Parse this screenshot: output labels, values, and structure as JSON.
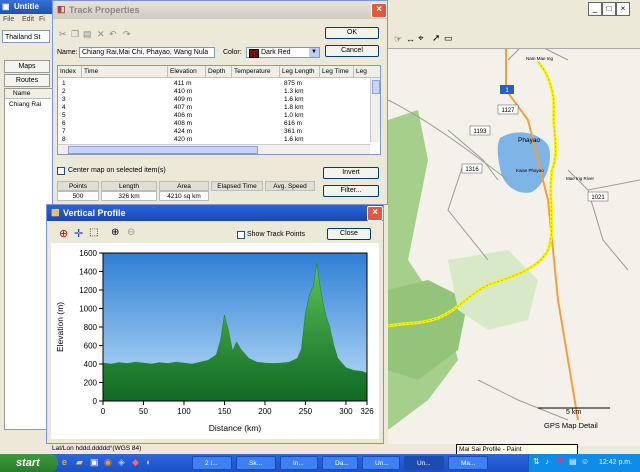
{
  "background_app": {
    "title": "Untitle",
    "menu": [
      "File",
      "Edit",
      "Fi"
    ],
    "region_combo": "Thailand St",
    "tabs": [
      "Maps",
      "Routes"
    ],
    "list_header": "Name",
    "list_item": "Chiang Rai"
  },
  "map": {
    "towns": [
      "Nam Mae Ing",
      "Phayao",
      "Kwan Phayao",
      "Mae Ing River"
    ],
    "road_labels": [
      "1",
      "1127",
      "1193",
      "1316",
      "1021"
    ],
    "scale_label": "5 km",
    "attribution": "GPS Map Detail",
    "colors": {
      "land": "#f3f1ea",
      "forest": "#a6cf8c",
      "lake": "#7fb5e6",
      "route": "#f5f500",
      "highway": "#f0a040"
    }
  },
  "track_properties": {
    "title": "Track Properties",
    "name_label": "Name:",
    "name_value": "Chiang Rai,Mai Chi, Phayao, Wang Nula",
    "color_label": "Color:",
    "color_value": "Dark Red",
    "color_swatch": "#7a0b0b",
    "ok_label": "OK",
    "cancel_label": "Cancel",
    "columns": [
      "Index",
      "Time",
      "Elevation",
      "Depth",
      "Temperature",
      "Leg Length",
      "Leg Time",
      "Leg"
    ],
    "rows": [
      {
        "index": "1",
        "elevation": "411 m",
        "leg_length": "875 m"
      },
      {
        "index": "2",
        "elevation": "410 m",
        "leg_length": "1.3 km"
      },
      {
        "index": "3",
        "elevation": "409 m",
        "leg_length": "1.6 km"
      },
      {
        "index": "4",
        "elevation": "407 m",
        "leg_length": "1.8 km"
      },
      {
        "index": "5",
        "elevation": "406 m",
        "leg_length": "1.0 km"
      },
      {
        "index": "6",
        "elevation": "408 m",
        "leg_length": "616 m"
      },
      {
        "index": "7",
        "elevation": "424 m",
        "leg_length": "361 m"
      },
      {
        "index": "8",
        "elevation": "420 m",
        "leg_length": "1.6 km"
      }
    ],
    "center_map_label": "Center map on selected item(s)",
    "invert_label": "Invert",
    "filter_label": "Filter...",
    "stats_headers": [
      "Points",
      "Length",
      "Area",
      "Elapsed Time",
      "Avg. Speed"
    ],
    "stats_values": [
      "500",
      "326 km",
      "4210 sq km",
      "",
      ""
    ]
  },
  "vertical_profile": {
    "title": "Vertical Profile",
    "show_track_points_label": "Show Track Points",
    "close_label": "Close"
  },
  "chart_data": {
    "type": "area",
    "title": "",
    "xlabel": "Distance   (km)",
    "ylabel": "Elevation  (m)",
    "xlim": [
      0,
      326
    ],
    "ylim": [
      0,
      1600
    ],
    "x_ticks": [
      0,
      50,
      100,
      150,
      200,
      250,
      300,
      326
    ],
    "y_ticks": [
      0,
      200,
      400,
      600,
      800,
      1000,
      1200,
      1400,
      1600
    ],
    "grid": false,
    "series": [
      {
        "color": "#1d8a2e",
        "x": [
          0,
          10,
          20,
          30,
          40,
          50,
          60,
          70,
          80,
          90,
          100,
          110,
          120,
          130,
          140,
          145,
          150,
          155,
          160,
          165,
          170,
          180,
          190,
          200,
          210,
          220,
          230,
          240,
          245,
          250,
          255,
          260,
          264,
          268,
          272,
          276,
          280,
          285,
          290,
          300,
          310,
          320,
          326
        ],
        "y": [
          410,
          400,
          415,
          405,
          420,
          410,
          400,
          415,
          405,
          420,
          410,
          400,
          420,
          440,
          500,
          650,
          930,
          760,
          540,
          640,
          560,
          460,
          420,
          410,
          405,
          410,
          420,
          460,
          560,
          950,
          1150,
          1250,
          1490,
          1250,
          1050,
          900,
          800,
          600,
          460,
          360,
          330,
          320,
          300
        ]
      }
    ]
  },
  "status_bar": "Lat/Lon hddd.ddddd°(WGS 84)",
  "tooltip": "Mai Sai Profile - Paint",
  "taskbar": {
    "start_label": "start",
    "tasks": [
      "2 I...",
      "Sk...",
      "In...",
      "Da...",
      "Un...",
      "Un...",
      "Ma..."
    ],
    "clock": "12:42 p.m."
  }
}
